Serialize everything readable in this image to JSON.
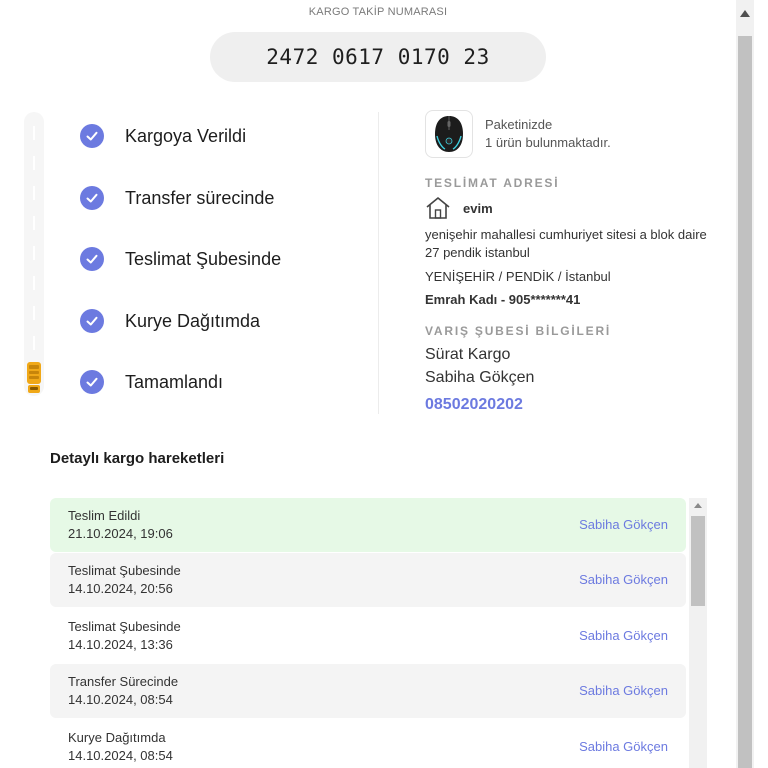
{
  "header": {
    "title": "KARGO TAKİP NUMARASI",
    "tracking_number": "2472 0617 0170 23"
  },
  "steps": [
    {
      "label": "Kargoya Verildi",
      "completed": true
    },
    {
      "label": "Transfer sürecinde",
      "completed": true
    },
    {
      "label": "Teslimat Şubesinde",
      "completed": true
    },
    {
      "label": "Kurye Dağıtımda",
      "completed": true
    },
    {
      "label": "Tamamlandı",
      "completed": true
    }
  ],
  "package": {
    "line1": "Paketinizde",
    "line2": "1 ürün bulunmaktadır.",
    "thumbnail_icon": "gaming-mouse-image"
  },
  "delivery_address": {
    "title": "TESLİMAT ADRESİ",
    "name": "evim",
    "icon": "home-icon",
    "address_line1": "yenişehir mahallesi cumhuriyet sitesi a blok daire",
    "address_line2": "27 pendik istanbul",
    "district": "YENİŞEHİR / PENDİK / İstanbul",
    "person": "Emrah Kadı - 905*******41"
  },
  "branch": {
    "title": "VARIŞ ŞUBESİ BİLGİLERİ",
    "company": "Sürat Kargo",
    "branch_name": "Sabiha Gökçen",
    "phone": "08502020202"
  },
  "movements": {
    "title": "Detaylı kargo hareketleri",
    "items": [
      {
        "status": "Teslim Edildi",
        "date": "21.10.2024, 19:06",
        "branch": "Sabiha Gökçen",
        "style": "done"
      },
      {
        "status": "Teslimat Şubesinde",
        "date": "14.10.2024, 20:56",
        "branch": "Sabiha Gökçen",
        "style": "alt"
      },
      {
        "status": "Teslimat Şubesinde",
        "date": "14.10.2024, 13:36",
        "branch": "Sabiha Gökçen",
        "style": "plain"
      },
      {
        "status": "Transfer Sürecinde",
        "date": "14.10.2024, 08:54",
        "branch": "Sabiha Gökçen",
        "style": "alt"
      },
      {
        "status": "Kurye Dağıtımda",
        "date": "14.10.2024, 08:54",
        "branch": "Sabiha Gökçen",
        "style": "plain"
      }
    ]
  },
  "colors": {
    "accent": "#6c7ae0",
    "delivered_row": "#e6f9e6",
    "alt_row": "#f4f4f4",
    "truck": "#f0a818"
  }
}
